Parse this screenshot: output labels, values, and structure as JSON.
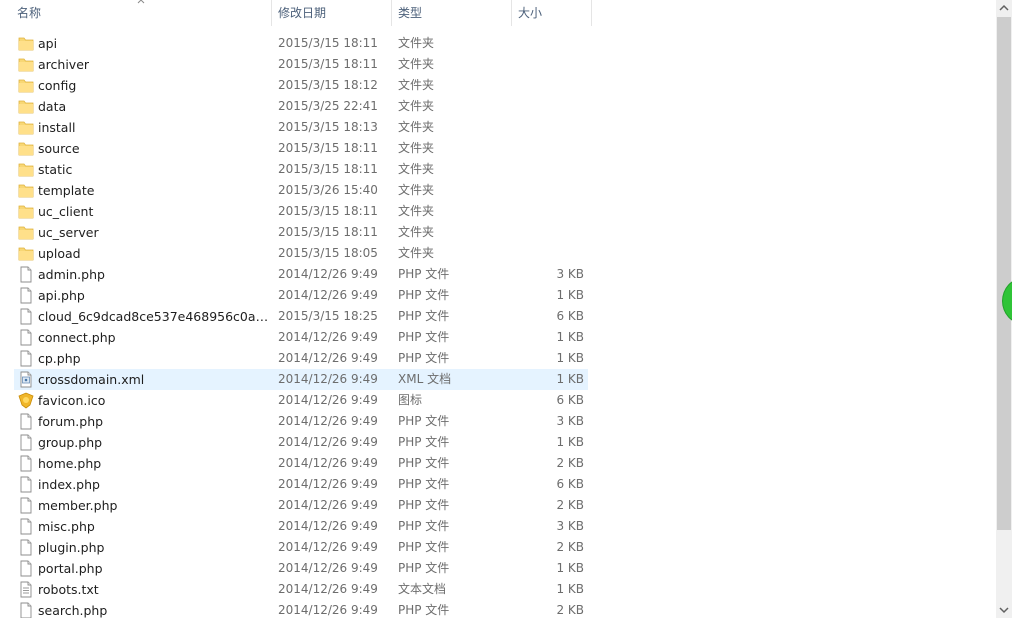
{
  "columns": {
    "name": "名称",
    "modified": "修改日期",
    "type": "类型",
    "size": "大小"
  },
  "files": [
    {
      "name": "api",
      "modified": "2015/3/15 18:11",
      "type": "文件夹",
      "size": "",
      "icon": "folder-icon"
    },
    {
      "name": "archiver",
      "modified": "2015/3/15 18:11",
      "type": "文件夹",
      "size": "",
      "icon": "folder-icon"
    },
    {
      "name": "config",
      "modified": "2015/3/15 18:12",
      "type": "文件夹",
      "size": "",
      "icon": "folder-icon"
    },
    {
      "name": "data",
      "modified": "2015/3/25 22:41",
      "type": "文件夹",
      "size": "",
      "icon": "folder-icon"
    },
    {
      "name": "install",
      "modified": "2015/3/15 18:13",
      "type": "文件夹",
      "size": "",
      "icon": "folder-icon"
    },
    {
      "name": "source",
      "modified": "2015/3/15 18:11",
      "type": "文件夹",
      "size": "",
      "icon": "folder-icon"
    },
    {
      "name": "static",
      "modified": "2015/3/15 18:11",
      "type": "文件夹",
      "size": "",
      "icon": "folder-icon"
    },
    {
      "name": "template",
      "modified": "2015/3/26 15:40",
      "type": "文件夹",
      "size": "",
      "icon": "folder-icon"
    },
    {
      "name": "uc_client",
      "modified": "2015/3/15 18:11",
      "type": "文件夹",
      "size": "",
      "icon": "folder-icon"
    },
    {
      "name": "uc_server",
      "modified": "2015/3/15 18:11",
      "type": "文件夹",
      "size": "",
      "icon": "folder-icon"
    },
    {
      "name": "upload",
      "modified": "2015/3/15 18:05",
      "type": "文件夹",
      "size": "",
      "icon": "folder-icon"
    },
    {
      "name": "admin.php",
      "modified": "2014/12/26 9:49",
      "type": "PHP 文件",
      "size": "3 KB",
      "icon": "file-icon"
    },
    {
      "name": "api.php",
      "modified": "2014/12/26 9:49",
      "type": "PHP 文件",
      "size": "1 KB",
      "icon": "file-icon"
    },
    {
      "name": "cloud_6c9dcad8ce537e468956c0a8a2...",
      "modified": "2015/3/15 18:25",
      "type": "PHP 文件",
      "size": "6 KB",
      "icon": "file-icon"
    },
    {
      "name": "connect.php",
      "modified": "2014/12/26 9:49",
      "type": "PHP 文件",
      "size": "1 KB",
      "icon": "file-icon"
    },
    {
      "name": "cp.php",
      "modified": "2014/12/26 9:49",
      "type": "PHP 文件",
      "size": "1 KB",
      "icon": "file-icon"
    },
    {
      "name": "crossdomain.xml",
      "modified": "2014/12/26 9:49",
      "type": "XML 文档",
      "size": "1 KB",
      "icon": "xml-file-icon",
      "selected": true
    },
    {
      "name": "favicon.ico",
      "modified": "2014/12/26 9:49",
      "type": "图标",
      "size": "6 KB",
      "icon": "image-icon"
    },
    {
      "name": "forum.php",
      "modified": "2014/12/26 9:49",
      "type": "PHP 文件",
      "size": "3 KB",
      "icon": "file-icon"
    },
    {
      "name": "group.php",
      "modified": "2014/12/26 9:49",
      "type": "PHP 文件",
      "size": "1 KB",
      "icon": "file-icon"
    },
    {
      "name": "home.php",
      "modified": "2014/12/26 9:49",
      "type": "PHP 文件",
      "size": "2 KB",
      "icon": "file-icon"
    },
    {
      "name": "index.php",
      "modified": "2014/12/26 9:49",
      "type": "PHP 文件",
      "size": "6 KB",
      "icon": "file-icon"
    },
    {
      "name": "member.php",
      "modified": "2014/12/26 9:49",
      "type": "PHP 文件",
      "size": "2 KB",
      "icon": "file-icon"
    },
    {
      "name": "misc.php",
      "modified": "2014/12/26 9:49",
      "type": "PHP 文件",
      "size": "3 KB",
      "icon": "file-icon"
    },
    {
      "name": "plugin.php",
      "modified": "2014/12/26 9:49",
      "type": "PHP 文件",
      "size": "2 KB",
      "icon": "file-icon"
    },
    {
      "name": "portal.php",
      "modified": "2014/12/26 9:49",
      "type": "PHP 文件",
      "size": "1 KB",
      "icon": "file-icon"
    },
    {
      "name": "robots.txt",
      "modified": "2014/12/26 9:49",
      "type": "文本文档",
      "size": "1 KB",
      "icon": "text-file-icon"
    },
    {
      "name": "search.php",
      "modified": "2014/12/26 9:49",
      "type": "PHP 文件",
      "size": "2 KB",
      "icon": "file-icon"
    }
  ],
  "colors": {
    "header_text": "#4c607a",
    "selection": "#e5f3ff",
    "folder": "#f8d775",
    "scrollbar_thumb": "#cdcdcd",
    "edge_widget": "#2fc437"
  }
}
